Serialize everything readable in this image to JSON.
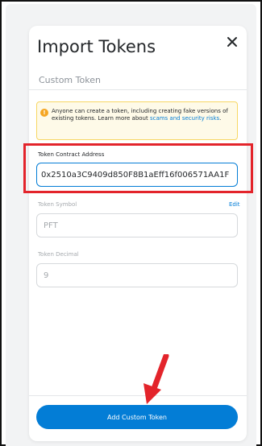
{
  "dialog": {
    "title": "Import Tokens",
    "tab": "Custom Token",
    "warning": {
      "text": "Anyone can create a token, including creating fake versions of existing tokens. Learn more about ",
      "link": "scams and security risks",
      "suffix": "."
    },
    "fields": {
      "address": {
        "label": "Token Contract Address",
        "value": "0x2510a3C9409d850F8B1aEff16f006571AA1F"
      },
      "symbol": {
        "label": "Token Symbol",
        "edit_label": "Edit",
        "value": "PFT"
      },
      "decimal": {
        "label": "Token Decimal",
        "value": "9"
      }
    },
    "submit_label": "Add Custom Token"
  },
  "icons": {
    "close": "close-icon",
    "warning": "warning-icon",
    "annotation_arrow": "arrow-icon"
  },
  "colors": {
    "primary": "#037dd6",
    "highlight": "#e3242b",
    "warning_bg": "#fefae8",
    "warning_border": "#f7d764"
  }
}
